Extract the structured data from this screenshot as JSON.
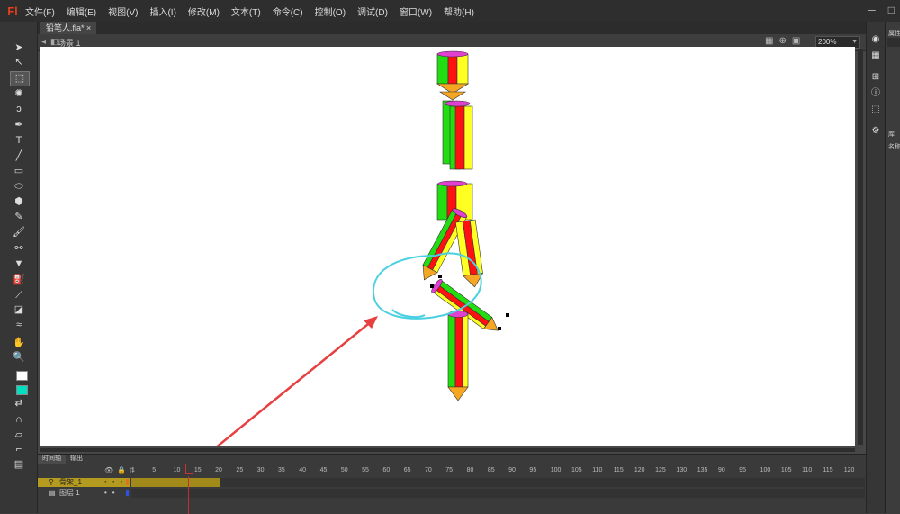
{
  "app": {
    "logo": "Fl",
    "menu": [
      "文件(F)",
      "编辑(E)",
      "视图(V)",
      "插入(I)",
      "修改(M)",
      "文本(T)",
      "命令(C)",
      "控制(O)",
      "调试(D)",
      "窗口(W)",
      "帮助(H)"
    ]
  },
  "document": {
    "tab_label": "铅笔人.fla*",
    "scene_label": "场景 1",
    "zoom": "200%"
  },
  "timeline": {
    "tabs": [
      "时间轴",
      "输出"
    ],
    "frame_numbers": [
      "1",
      "5",
      "10",
      "15",
      "20",
      "25",
      "30",
      "35",
      "40",
      "45",
      "50",
      "55",
      "60",
      "65",
      "70",
      "75",
      "80",
      "85",
      "90",
      "95",
      "100",
      "105",
      "110",
      "115",
      "120",
      "125",
      "130",
      "135",
      "90",
      "95",
      "100",
      "105",
      "110",
      "115",
      "120"
    ],
    "layers": [
      {
        "name": "骨架_1",
        "selected": true
      },
      {
        "name": "图层 1",
        "selected": false
      }
    ]
  },
  "right_panel": {
    "properties_label": "属性",
    "library_label": "库",
    "name_label": "名称"
  },
  "colors": {
    "stage_bg": "#ffffff",
    "pencil_green": "#22dd11",
    "pencil_red": "#ff1111",
    "pencil_yellow": "#ffff22",
    "pencil_tip": "#f5a623",
    "pencil_eraser": "#e040d0",
    "annotation_cyan": "#4ad0e0",
    "annotation_arrow": "#e84040",
    "fill_color": "#00e0c0"
  }
}
